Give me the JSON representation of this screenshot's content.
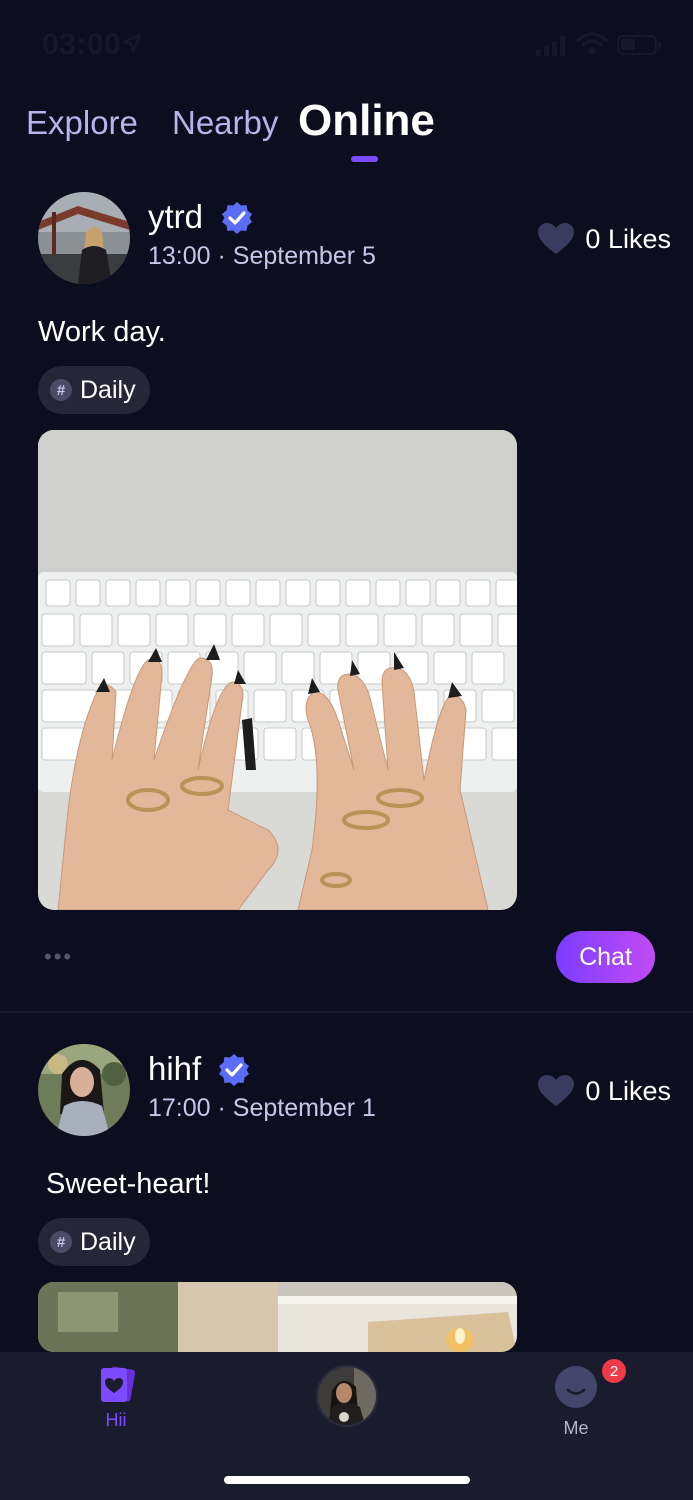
{
  "status_bar": {
    "time": "03:00"
  },
  "tabs": [
    {
      "label": "Explore"
    },
    {
      "label": "Nearby"
    },
    {
      "label": "Online",
      "active": true
    }
  ],
  "posts": [
    {
      "username": "ytrd",
      "verified": true,
      "time": "13:00 · September 5",
      "likes_count": "0",
      "likes_label": "Likes",
      "text": "Work day.",
      "tag": "Daily",
      "image_icon": "keyboard-photo",
      "chat_label": "Chat"
    },
    {
      "username": "hihf",
      "verified": true,
      "time": "17:00 · September 1",
      "likes_count": "0",
      "likes_label": "Likes",
      "text": "Sweet-heart!",
      "tag": "Daily",
      "image_icon": "room-photo"
    }
  ],
  "bottom_nav": {
    "hii_label": "Hii",
    "me_label": "Me",
    "me_badge": "2"
  },
  "colors": {
    "background": "#0c0d1e",
    "accent": "#7b4cff",
    "verified": "#5b6cf7",
    "badge": "#f03a47"
  }
}
